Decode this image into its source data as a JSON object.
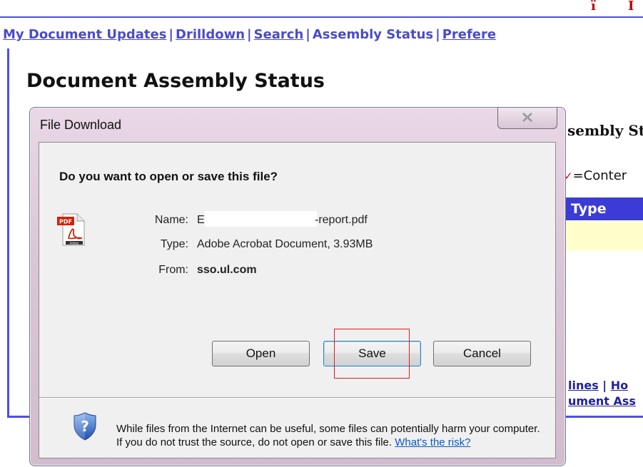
{
  "nav": {
    "items": [
      {
        "label": "My Document Updates",
        "link": true
      },
      {
        "label": "Drilldown",
        "link": true
      },
      {
        "label": "Search",
        "link": true
      },
      {
        "label": "Assembly Status",
        "link": false
      },
      {
        "label": "Prefere",
        "link": true
      }
    ],
    "separator": "|"
  },
  "page": {
    "title": "Document Assembly Status",
    "heading_fragment": "sembly St",
    "legend_fragment": "=Conter",
    "table_header_fragment": "Type",
    "footer_line1_link_a": "lines",
    "footer_line1_sep": " | ",
    "footer_line1_link_b": "Ho",
    "footer_line2": "ument Ass"
  },
  "dialog": {
    "title": "File Download",
    "question": "Do you want to open or save this file?",
    "name_label": "Name:",
    "name_prefix": "E:",
    "name_suffix": "-report.pdf",
    "type_label": "Type:",
    "type_value": "Adobe Acrobat Document, 3.93MB",
    "from_label": "From:",
    "from_value": "sso.ul.com",
    "buttons": {
      "open": "Open",
      "save": "Save",
      "cancel": "Cancel"
    },
    "warning_text": "While files from the Internet can be useful, some files can potentially harm your computer. If you do not trust the source, do not open or save this file.",
    "risk_link": "What's the risk?",
    "icon_label": "PDF",
    "icon_sublabel": "Adobe"
  },
  "colors": {
    "nav_link": "#4b4bc8",
    "frame_border": "#4d4df0",
    "table_header": "#3b3bd6",
    "table_row": "#ffffcc",
    "highlight": "#e01b1b",
    "link_blue": "#0a58c8"
  }
}
